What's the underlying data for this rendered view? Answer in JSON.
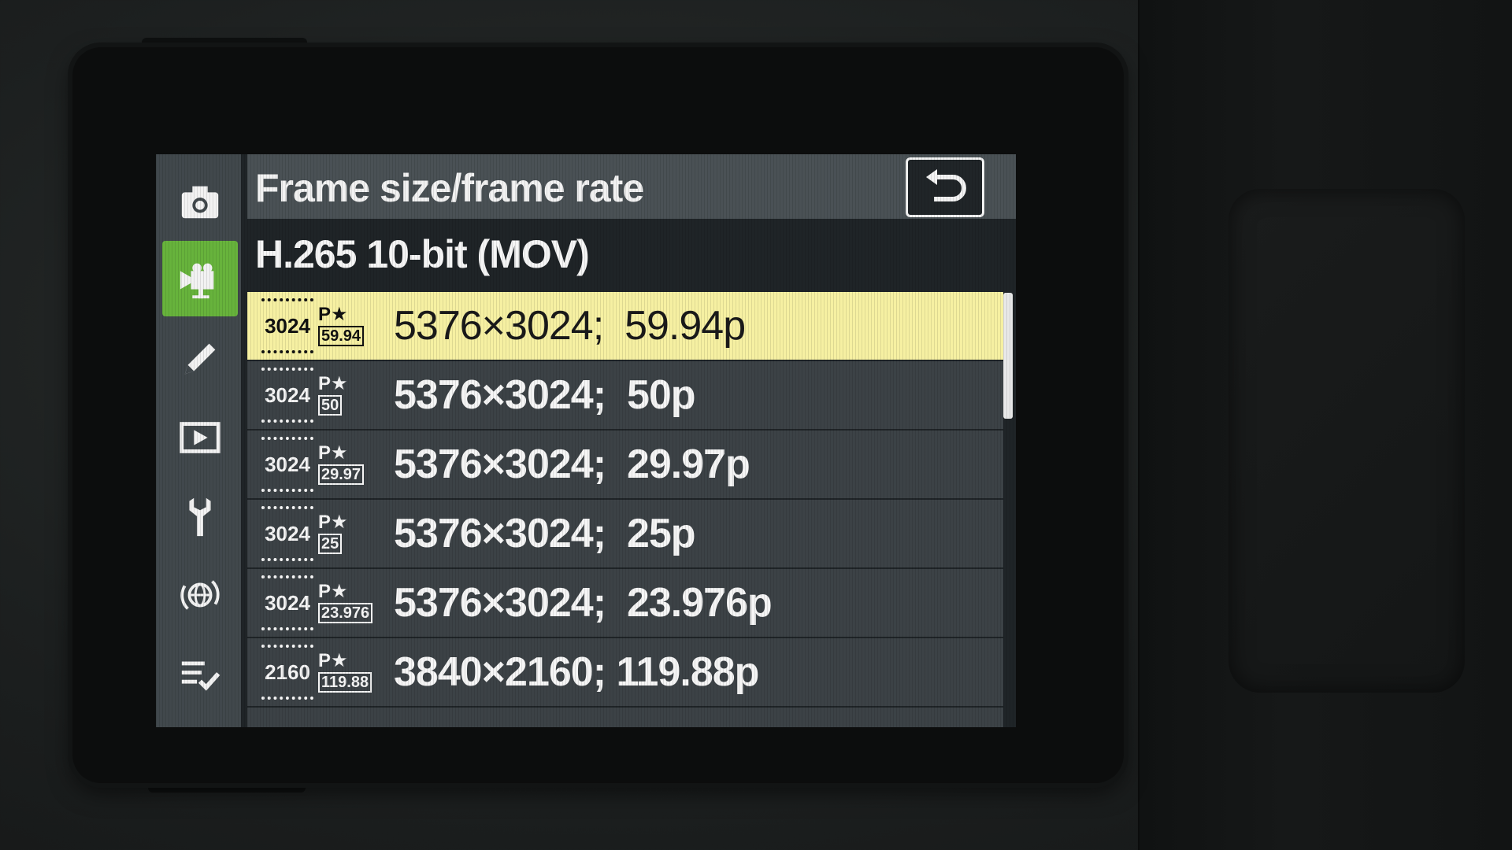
{
  "menu": {
    "title": "Frame size/frame rate",
    "subtitle": "H.265 10-bit (MOV)",
    "back_icon": "back-arrow-icon",
    "rail": [
      {
        "icon": "camera-icon",
        "active": false
      },
      {
        "icon": "movie-camera-icon",
        "active": true
      },
      {
        "icon": "pencil-icon",
        "active": false
      },
      {
        "icon": "playback-icon",
        "active": false
      },
      {
        "icon": "wrench-icon",
        "active": false
      },
      {
        "icon": "network-icon",
        "active": false
      },
      {
        "icon": "my-menu-icon",
        "active": false
      }
    ],
    "items": [
      {
        "res_icon": "3024",
        "rate_icon": "59.94",
        "label": "5376×3024;  59.94p",
        "selected": true
      },
      {
        "res_icon": "3024",
        "rate_icon": "50",
        "label": "5376×3024;  50p",
        "selected": false
      },
      {
        "res_icon": "3024",
        "rate_icon": "29.97",
        "label": "5376×3024;  29.97p",
        "selected": false
      },
      {
        "res_icon": "3024",
        "rate_icon": "25",
        "label": "5376×3024;  25p",
        "selected": false
      },
      {
        "res_icon": "3024",
        "rate_icon": "23.976",
        "label": "5376×3024;  23.976p",
        "selected": false
      },
      {
        "res_icon": "2160",
        "rate_icon": "119.88",
        "label": "3840×2160; 119.88p",
        "selected": false
      }
    ],
    "colors": {
      "active_tab": "#67b33c",
      "selected_row": "#f6f0a2",
      "row": "#3c4246",
      "rail": "#41484c"
    }
  }
}
